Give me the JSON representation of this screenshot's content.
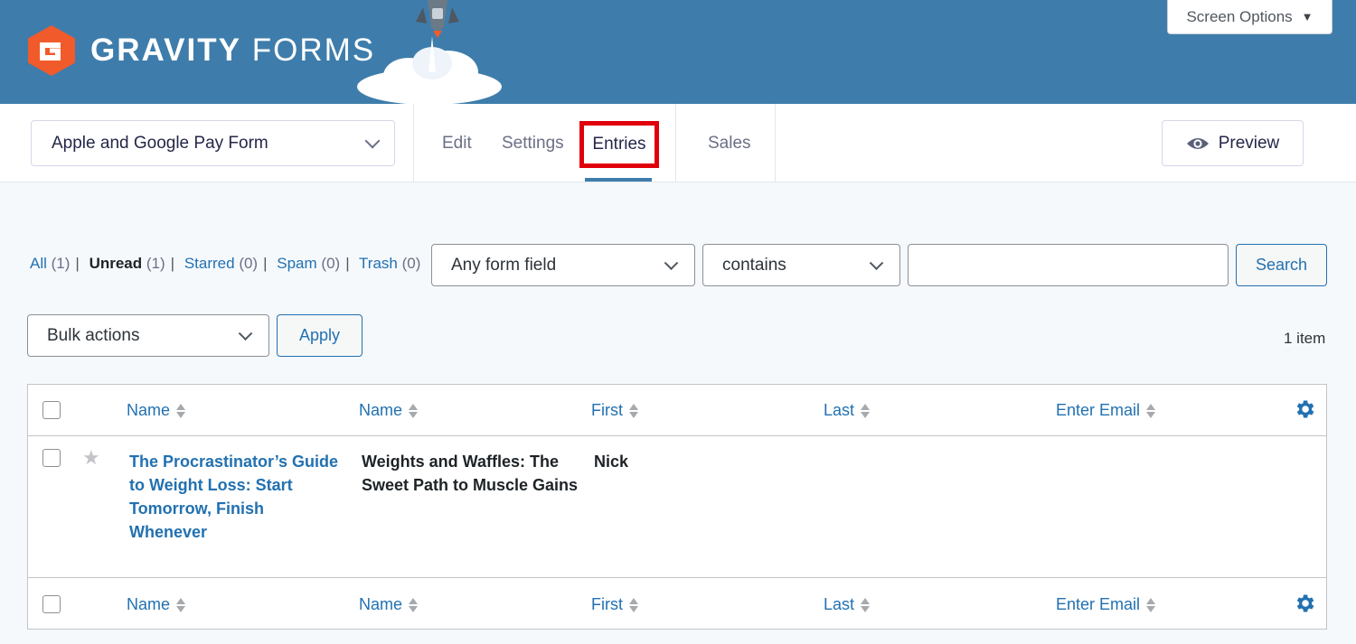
{
  "header": {
    "brand_bold": "GRAVITY",
    "brand_light": "FORMS",
    "screen_options_label": "Screen Options"
  },
  "toolbar": {
    "form_name": "Apple and Google Pay Form",
    "tabs": [
      {
        "label": "Edit"
      },
      {
        "label": "Settings"
      },
      {
        "label": "Entries",
        "active": true
      },
      {
        "label": "Sales"
      }
    ],
    "preview_label": "Preview"
  },
  "filters": {
    "links": [
      {
        "label": "All",
        "count": "(1)"
      },
      {
        "label": "Unread",
        "count": "(1)",
        "current": true
      },
      {
        "label": "Starred",
        "count": "(0)"
      },
      {
        "label": "Spam",
        "count": "(0)"
      },
      {
        "label": "Trash",
        "count": "(0)"
      }
    ],
    "field_select": "Any form field",
    "operator_select": "contains",
    "search_value": "",
    "search_label": "Search"
  },
  "bulk": {
    "select_label": "Bulk actions",
    "apply_label": "Apply",
    "item_count": "1 item"
  },
  "table": {
    "columns": [
      "Name",
      "Name",
      "First",
      "Last",
      "Enter Email"
    ],
    "rows": [
      {
        "starred": false,
        "cells": [
          "The Procrastinator’s Guide to Weight Loss: Start Tomorrow, Finish Whenever",
          "Weights and Waffles: The Sweet Path to Muscle Gains",
          "Nick",
          "",
          ""
        ]
      }
    ]
  },
  "colors": {
    "header_bg": "#3e7dab",
    "logo_orange": "#f15a2b",
    "highlight_box": "#e0000b",
    "link_blue": "#2271b1"
  }
}
